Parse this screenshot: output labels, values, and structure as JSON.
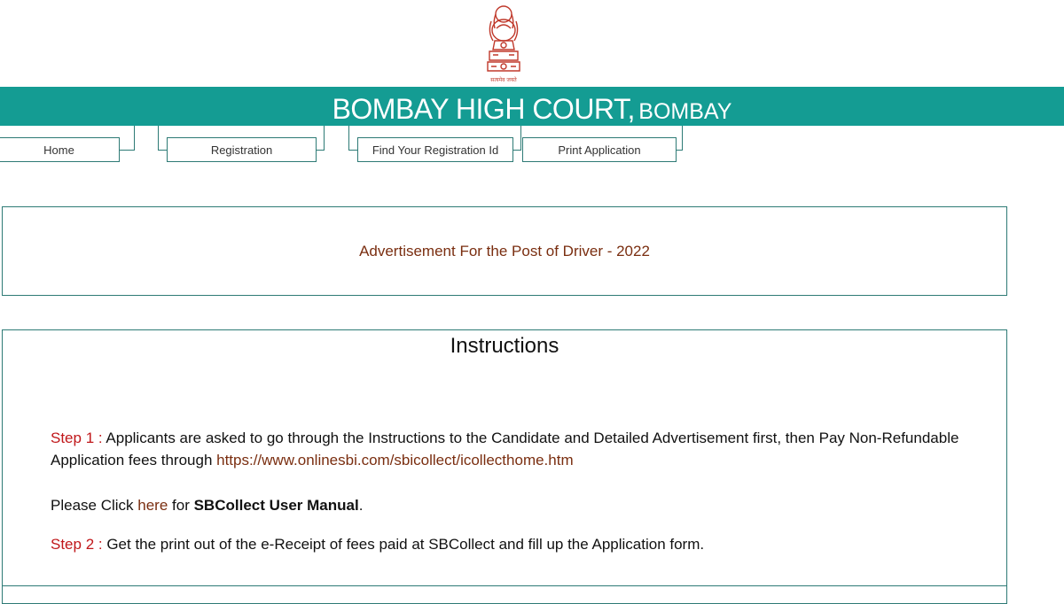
{
  "header": {
    "title_main": "BOMBAY HIGH COURT,",
    "title_city": "BOMBAY",
    "emblem_motto": "सत्यमेव जयते"
  },
  "nav": {
    "tabs": [
      {
        "label": "Home"
      },
      {
        "label": "Registration"
      },
      {
        "label": "Find Your Registration Id"
      },
      {
        "label": "Print Application"
      }
    ]
  },
  "advertisement": {
    "text": "Advertisement For the Post of Driver - 2022"
  },
  "instructions": {
    "heading": "Instructions",
    "step1_label": "Step 1 :",
    "step1_text": " Applicants are asked to go through the Instructions to the Candidate and Detailed Advertisement first, then Pay Non-Refundable Application fees through ",
    "step1_link": "https://www.onlinesbi.com/sbicollect/icollecthome.htm",
    "manual_prefix": "Please Click ",
    "manual_link": "here",
    "manual_mid": " for ",
    "manual_bold": "SBCollect User Manual",
    "manual_suffix": ".",
    "step2_label": "Step 2 :",
    "step2_text": " Get the print out of the e-Receipt of fees paid at SBCollect and fill up the Application form."
  },
  "colors": {
    "header_teal": "#149c93",
    "border_teal": "#2d7a75",
    "link_brown": "#7a2e10",
    "step_red": "#c0171a",
    "emblem_red": "#c0392b"
  }
}
